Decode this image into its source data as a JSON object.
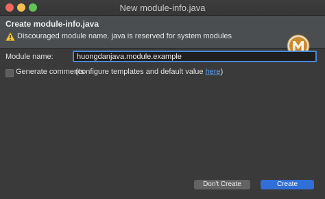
{
  "window": {
    "title": "New module-info.java"
  },
  "banner": {
    "title": "Create module-info.java",
    "message": "Discouraged module name. java is reserved for system modules",
    "warning_icon": "warning-icon",
    "logo_icon": "eclipse-m-logo-icon"
  },
  "form": {
    "module_name_label": "Module name:",
    "module_name_value": "huongdanjava.module.example",
    "generate_comments_label": "Generate comments",
    "generate_comments_checked": false,
    "configure_text_before": "(configure templates and default value ",
    "configure_link": "here",
    "configure_text_after": ")"
  },
  "buttons": {
    "dont_create": "Don't Create",
    "create": "Create"
  },
  "colors": {
    "accent": "#2f6fd6",
    "link": "#5aa0f0",
    "close": "#ed6a5e",
    "minimize": "#f5bf4f",
    "maximize": "#61c554"
  }
}
